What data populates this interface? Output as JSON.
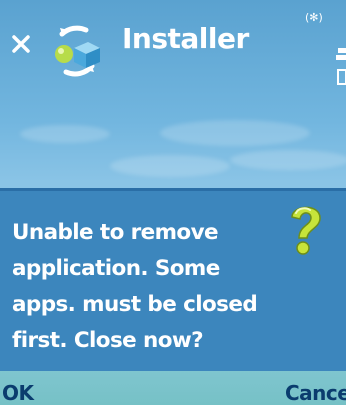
{
  "header": {
    "title": "Installer",
    "close_icon": "close-icon",
    "app_icon": "installer-icon",
    "status_indicator": "(✻)"
  },
  "dialog": {
    "lines": [
      "Unable to remove",
      "application. Some",
      "apps. must be closed",
      "first. Close now?"
    ],
    "icon": "question-icon"
  },
  "softkeys": {
    "left": "OK",
    "right": "Cancel"
  },
  "colors": {
    "dialog_background": "#3c86bd",
    "softkey_text": "#0a3c6e",
    "question_icon": "#c7e43a"
  }
}
